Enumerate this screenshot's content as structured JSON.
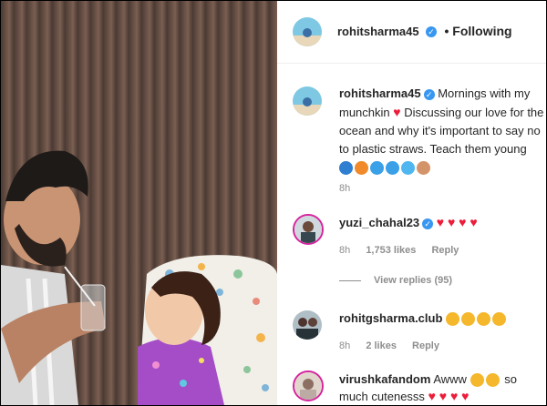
{
  "header": {
    "username": "rohitsharma45",
    "follow_label": "• Following"
  },
  "caption": {
    "username": "rohitsharma45",
    "text_part1": "Mornings with my munchkin",
    "text_part2": "Discussing our love for the ocean and why it's important to say no to plastic straws. Teach them young",
    "time": "8h"
  },
  "comments": [
    {
      "username": "yuzi_chahal23",
      "text": "",
      "time": "8h",
      "likes": "1,753 likes",
      "reply_label": "Reply",
      "icon": "hearts"
    },
    {
      "username": "rohitgsharma.club",
      "text": "",
      "time": "8h",
      "likes": "2 likes",
      "reply_label": "Reply",
      "icon": "heart-eyes"
    },
    {
      "username": "virushkafandom",
      "text_part1": "Awww",
      "text_part2": "so much cutenesss",
      "icon": "crying-hearts"
    }
  ],
  "view_replies": "View replies (95)",
  "colors": {
    "accent_blue": "#3897f0",
    "heart_red": "#ed1c38",
    "muted": "#8e8e8e",
    "text": "#262626"
  }
}
